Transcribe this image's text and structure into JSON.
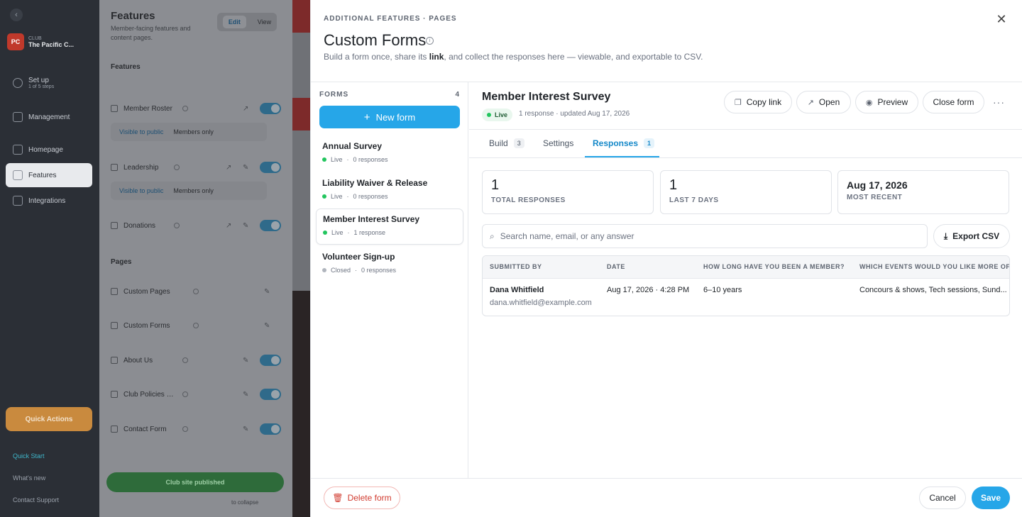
{
  "nav": {
    "club_label": "CLUB",
    "club_name": "The Pacific C...",
    "club_badge": "PC",
    "setup": {
      "label": "Set up",
      "sub": "1 of 5 steps"
    },
    "items": [
      {
        "label": "Management"
      },
      {
        "label": "Homepage"
      },
      {
        "label": "Features"
      },
      {
        "label": "Integrations"
      }
    ],
    "quick_actions": "Quick Actions",
    "footer": [
      {
        "label": "Quick Start"
      },
      {
        "label": "What's new"
      },
      {
        "label": "Contact Support"
      }
    ]
  },
  "panel": {
    "title": "Features",
    "description": "Member-facing features and content pages.",
    "mode": {
      "edit": "Edit",
      "view": "View"
    },
    "features_header": "Features",
    "pages_header": "Pages",
    "visibility": {
      "public": "Visible to public",
      "members": "Members only"
    },
    "rows": [
      {
        "label": "Member Roster"
      },
      {
        "label": "Leadership"
      },
      {
        "label": "Donations"
      },
      {
        "label": "Custom Pages"
      },
      {
        "label": "Custom Forms"
      },
      {
        "label": "About Us"
      },
      {
        "label": "Club Policies & Guide..."
      },
      {
        "label": "Contact Form"
      }
    ],
    "published": "Club site published",
    "collapse": "to collapse"
  },
  "modal": {
    "breadcrumb": "ADDITIONAL FEATURES · PAGES",
    "title": "Custom Forms",
    "subtitle_pre": "Build a form once, share its ",
    "subtitle_bold": "link",
    "subtitle_post": ", and collect the responses here — viewable, and exportable to CSV.",
    "close_glyph": "✕",
    "forms_header": "FORMS",
    "forms_count": "4",
    "new_form": "New form",
    "forms": [
      {
        "name": "Annual Survey",
        "status": "Live",
        "responses": "0 responses"
      },
      {
        "name": "Liability Waiver & Release",
        "status": "Live",
        "responses": "0 responses"
      },
      {
        "name": "Member Interest Survey",
        "status": "Live",
        "responses": "1 response"
      },
      {
        "name": "Volunteer Sign-up",
        "status": "Closed",
        "responses": "0 responses"
      }
    ],
    "selected": {
      "name": "Member Interest Survey",
      "status": "Live",
      "updated": "1 response · updated Aug 17, 2026"
    },
    "actions": {
      "copy_link": "Copy link",
      "open": "Open",
      "preview": "Preview",
      "close_form": "Close form",
      "more": "···"
    },
    "tabs": [
      {
        "label": "Build",
        "count": "3"
      },
      {
        "label": "Settings"
      },
      {
        "label": "Responses",
        "count": "1"
      }
    ],
    "stats": [
      {
        "value": "1",
        "label": "TOTAL RESPONSES"
      },
      {
        "value": "1",
        "label": "LAST 7 DAYS"
      },
      {
        "value": "Aug 17, 2026",
        "label": "MOST RECENT"
      }
    ],
    "search_placeholder": "Search name, email, or any answer",
    "export": "Export CSV",
    "table": {
      "headers": [
        "SUBMITTED BY",
        "DATE",
        "HOW LONG HAVE YOU BEEN A MEMBER?",
        "WHICH EVENTS WOULD YOU LIKE MORE OF"
      ],
      "rows": [
        {
          "name": "Dana Whitfield",
          "email": "dana.whitfield@example.com",
          "date": "Aug 17, 2026 · 4:28 PM",
          "tenure": "6–10 years",
          "events": "Concours & shows, Tech sessions, Sund..."
        }
      ]
    },
    "delete": "Delete form",
    "cancel": "Cancel",
    "save": "Save"
  },
  "colors": {
    "accent": "#26a6e8",
    "live": "#22c55e",
    "danger": "#d13b2f"
  }
}
